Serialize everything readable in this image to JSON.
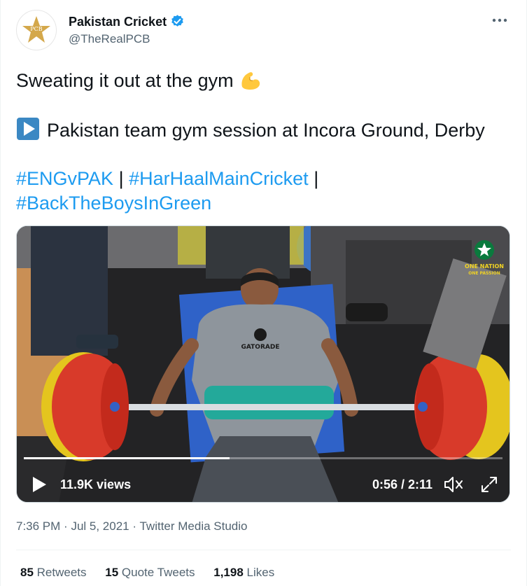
{
  "account": {
    "name": "Pakistan Cricket",
    "handle": "@TheRealPCB",
    "verified_icon": "verified-badge-icon",
    "brand_color": "#1d9bf0"
  },
  "tweet": {
    "line1_text": "Sweating it out at the gym",
    "line1_emoji": "flexed-biceps",
    "line2_text": "Pakistan team gym session at Incora Ground, Derby",
    "line2_emoji": "play-button",
    "hashtags": [
      "#ENGvPAK",
      "#HarHaalMainCricket",
      "#BackTheBoysInGreen"
    ],
    "separator": "|"
  },
  "video": {
    "views": "11.9K views",
    "time": "0:56 / 2:11",
    "progress_fraction": 0.43,
    "badge_line1": "ONE NATION",
    "badge_line2": "ONE PASSION",
    "shirt_text": "GATORADE"
  },
  "meta": {
    "time": "7:36 PM",
    "date": "Jul 5, 2021",
    "source": "Twitter Media Studio",
    "dot": "·"
  },
  "stats": {
    "retweets_count": "85",
    "retweets_label": "Retweets",
    "quotes_count": "15",
    "quotes_label": "Quote Tweets",
    "likes_count": "1,198",
    "likes_label": "Likes"
  }
}
